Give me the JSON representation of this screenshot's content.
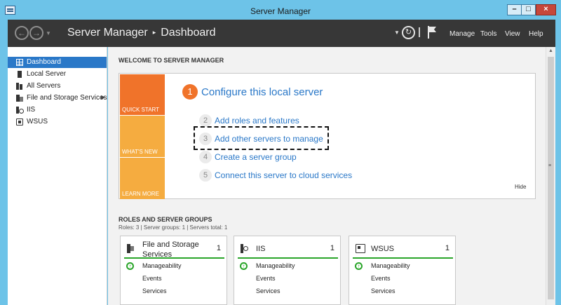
{
  "window": {
    "title": "Server Manager"
  },
  "header": {
    "breadcrumb_app": "Server Manager",
    "breadcrumb_sep": "▸",
    "breadcrumb_page": "Dashboard",
    "menus": [
      "Manage",
      "Tools",
      "View",
      "Help"
    ]
  },
  "sidebar": {
    "items": [
      {
        "label": "Dashboard",
        "icon": "dashboard-icon",
        "active": true
      },
      {
        "label": "Local Server",
        "icon": "server-icon"
      },
      {
        "label": "All Servers",
        "icon": "servers-icon"
      },
      {
        "label": "File and Storage Services",
        "icon": "storage-icon",
        "has_submenu": true
      },
      {
        "label": "IIS",
        "icon": "iis-icon"
      },
      {
        "label": "WSUS",
        "icon": "wsus-icon"
      }
    ]
  },
  "welcome": {
    "title": "WELCOME TO SERVER MANAGER",
    "tiles": [
      "QUICK START",
      "WHAT'S NEW",
      "LEARN MORE"
    ],
    "main_step": {
      "num": "1",
      "text": "Configure this local server"
    },
    "steps": [
      {
        "num": "2",
        "text": "Add roles and features"
      },
      {
        "num": "3",
        "text": "Add other servers to manage"
      },
      {
        "num": "4",
        "text": "Create a server group"
      },
      {
        "num": "5",
        "text": "Connect this server to cloud services"
      }
    ],
    "hide": "Hide"
  },
  "roles": {
    "title": "ROLES AND SERVER GROUPS",
    "stats": "Roles: 3   |   Server groups: 1   |   Servers total: 1",
    "cards": [
      {
        "title": "File and Storage Services",
        "count": "1",
        "icon": "storage-icon",
        "rows": [
          "Manageability",
          "Events",
          "Services"
        ]
      },
      {
        "title": "IIS",
        "count": "1",
        "icon": "iis-icon",
        "rows": [
          "Manageability",
          "Events",
          "Services"
        ]
      },
      {
        "title": "WSUS",
        "count": "1",
        "icon": "wsus-icon",
        "rows": [
          "Manageability",
          "Events",
          "Services"
        ]
      }
    ]
  },
  "colors": {
    "accent": "#2a78c8",
    "quick_start": "#f0732a",
    "tile_secondary": "#f5ac40",
    "status_ok": "#2aa52a",
    "header_bg": "#373737",
    "frame": "#6dc3e8"
  }
}
